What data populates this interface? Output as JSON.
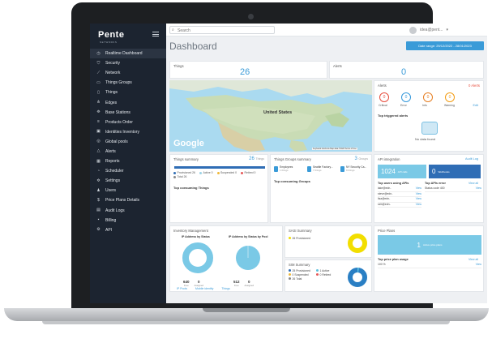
{
  "app": {
    "logo": "Pente",
    "logo_sub": "NETWORKS"
  },
  "search": {
    "placeholder": "Search"
  },
  "user": {
    "name": "idea@pent..."
  },
  "header": {
    "title": "Dashboard",
    "date_range": "Date range: 29/12/2022 - 28/01/2023"
  },
  "sidebar": {
    "items": [
      {
        "label": "Realtime Dashboard",
        "icon": "dashboard-icon"
      },
      {
        "label": "Security",
        "icon": "shield-icon"
      },
      {
        "label": "Network",
        "icon": "network-icon"
      },
      {
        "label": "Things Groups",
        "icon": "folder-icon"
      },
      {
        "label": "Things",
        "icon": "device-icon"
      },
      {
        "label": "Edges",
        "icon": "edges-icon"
      },
      {
        "label": "Base Stations",
        "icon": "antenna-icon"
      },
      {
        "label": "Products Order",
        "icon": "list-icon"
      },
      {
        "label": "Identities Inventory",
        "icon": "id-icon"
      },
      {
        "label": "Global pools",
        "icon": "globe-icon"
      },
      {
        "label": "Alerts",
        "icon": "bell-icon"
      },
      {
        "label": "Reports",
        "icon": "reports-icon"
      },
      {
        "label": "Scheduler",
        "icon": "clock-icon"
      },
      {
        "label": "Settings",
        "icon": "settings-icon"
      },
      {
        "label": "Users",
        "icon": "users-icon"
      },
      {
        "label": "Price Plans Details",
        "icon": "dollar-icon"
      },
      {
        "label": "Audit Logs",
        "icon": "audit-icon"
      },
      {
        "label": "Billing",
        "icon": "billing-icon"
      },
      {
        "label": "API",
        "icon": "api-icon"
      }
    ]
  },
  "things_card": {
    "title": "Things",
    "value": "26"
  },
  "alerts_card": {
    "title": "Alerts",
    "value": "0"
  },
  "map": {
    "label_us": "United States",
    "google": "Google",
    "attrib": "Keyboard shortcuts  Map data ©2023  Terms of Use"
  },
  "alerts_panel": {
    "title": "Alerts",
    "count": "0 Alerts",
    "circles": [
      {
        "value": "0",
        "label": "Critical",
        "color": "#e74c3c"
      },
      {
        "value": "0",
        "label": "Error",
        "color": "#3498db"
      },
      {
        "value": "0",
        "label": "Info",
        "color": "#e67e22"
      },
      {
        "value": "0",
        "label": "Warning",
        "color": "#f39c12"
      }
    ],
    "edit": "Edit",
    "top_label": "Top triggered alerts",
    "no_data": "No data found"
  },
  "things_summary": {
    "title": "Things summary",
    "count": "26",
    "count_unit": "Things",
    "legend": [
      {
        "label": "Provisioned",
        "value": "26",
        "color": "#2f6db5"
      },
      {
        "label": "Active",
        "value": "0",
        "color": "#9bd2e6"
      },
      {
        "label": "Suspended",
        "value": "0",
        "color": "#f0b93a"
      },
      {
        "label": "Retired",
        "value": "0",
        "color": "#e65a5a"
      },
      {
        "label": "Total",
        "value": "26",
        "color": "#888"
      }
    ],
    "top_label": "Top consuming Things"
  },
  "groups_summary": {
    "title": "Things Groups summary",
    "count": "3",
    "count_unit": "Groups",
    "groups": [
      {
        "name": "Employees",
        "sub": "1 things"
      },
      {
        "name": "Seattle Factory...",
        "sub": "7 things"
      },
      {
        "name": "NY Security Ca...",
        "sub": "9 things"
      }
    ],
    "top_label": "Top consuming Groups"
  },
  "api": {
    "title": "API integration",
    "audit_link": "Audit Log",
    "calls": "1024",
    "calls_label": "API calls",
    "webhooks": "0",
    "webhooks_label": "Webhooks",
    "users_title": "Top users using APIs",
    "errors_title": "Top APIs error",
    "view_all": "View all",
    "users": [
      {
        "name": "lake@edn-",
        "link": "View"
      },
      {
        "name": "steve@edn-",
        "link": "View"
      },
      {
        "name": "lisa@edn-",
        "link": "View"
      },
      {
        "name": "seb@edn-",
        "link": "View"
      }
    ],
    "errors": [
      {
        "name": "Status code 400",
        "link": "View"
      }
    ]
  },
  "inventory": {
    "title": "Inventory Management",
    "donut1_title": "IP Address by Status",
    "donut2_title": "IP Address by Status by Pool",
    "d1_legend": [
      {
        "v": "640",
        "l": "Free"
      },
      {
        "v": "0",
        "l": "Assigned"
      }
    ],
    "d2_legend": [
      {
        "v": "512",
        "l": "Free"
      },
      {
        "v": "0",
        "l": "Assigned"
      }
    ],
    "links": [
      "IP Pools",
      "Mobile identity",
      "Things"
    ]
  },
  "sim_summary": {
    "title": "SASI Summary",
    "legend": [
      {
        "label": "26 Provisioned",
        "color": "#f2de00"
      }
    ]
  },
  "esim_summary": {
    "title": "SIM Summary",
    "legend": [
      {
        "label": "25 Provisioned",
        "color": "#2f6db5"
      },
      {
        "label": "1 Active",
        "color": "#5bc0de"
      },
      {
        "label": "0 Suspended",
        "color": "#f0b93a"
      },
      {
        "label": "0 Retired",
        "color": "#e65a5a"
      },
      {
        "label": "26 Total",
        "color": "#888"
      }
    ]
  },
  "price_plans": {
    "title": "Price Plans",
    "banner": "1",
    "banner_label": "Active price plans",
    "usage_title": "Top price plan usage",
    "view_all": "View all",
    "rows": [
      {
        "name": "100 %",
        "link": "View"
      }
    ]
  },
  "colors": {
    "sidebar": "#1c2430",
    "accent": "#3a9bd8",
    "light_blue": "#7ac9e6",
    "yellow": "#f2de00",
    "blue": "#2a7fc4"
  }
}
